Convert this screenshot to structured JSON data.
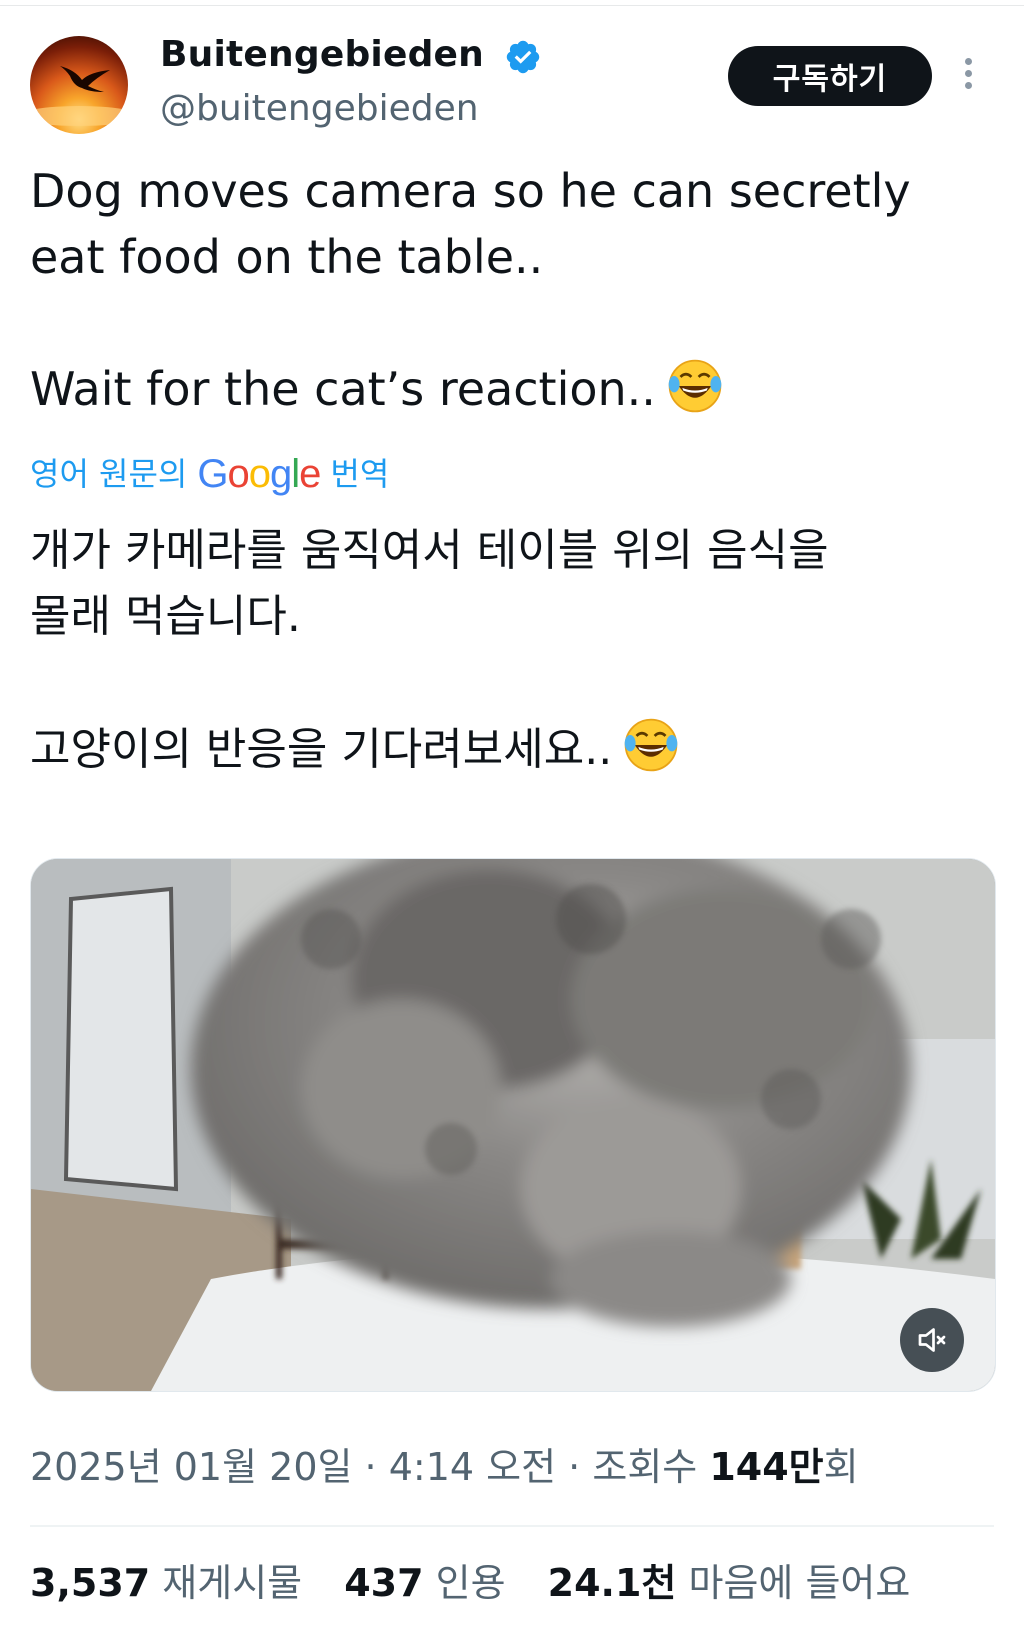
{
  "author": {
    "display_name": "Buitengebieden",
    "handle": "@buitengebieden"
  },
  "header": {
    "subscribe_label": "구독하기"
  },
  "icons": {
    "verified": "verified-badge-icon",
    "more": "more-options-icon",
    "emoji": "face-with-tears-of-joy-emoji",
    "mute": "speaker-muted-icon"
  },
  "tweet": {
    "line1": "Dog moves camera so he can secretly",
    "line2": "eat food on the table..",
    "line3": "Wait for the cat’s reaction.."
  },
  "translation": {
    "prefix": "영어 원문의",
    "provider": "Google",
    "suffix": "번역",
    "line1": "개가 카메라를 움직여서 테이블 위의 음식을",
    "line2": "몰래 먹습니다.",
    "line3": "고양이의 반응을 기다려보세요.."
  },
  "meta": {
    "date": "2025년 01월 20일",
    "separator": "·",
    "time": "4:14 오전",
    "views_label": "조회수",
    "views_value": "144만",
    "views_suffix": "회"
  },
  "stats": {
    "reposts_value": "3,537",
    "reposts_label": "재게시물",
    "quotes_value": "437",
    "quotes_label": "인용",
    "likes_value": "24.1천",
    "likes_label": "마음에 들어요"
  },
  "colors": {
    "text": "#0f1419",
    "secondary": "#536471",
    "link": "#1d9bf0",
    "verified": "#1d9bf0",
    "button_bg": "#0f1419"
  }
}
